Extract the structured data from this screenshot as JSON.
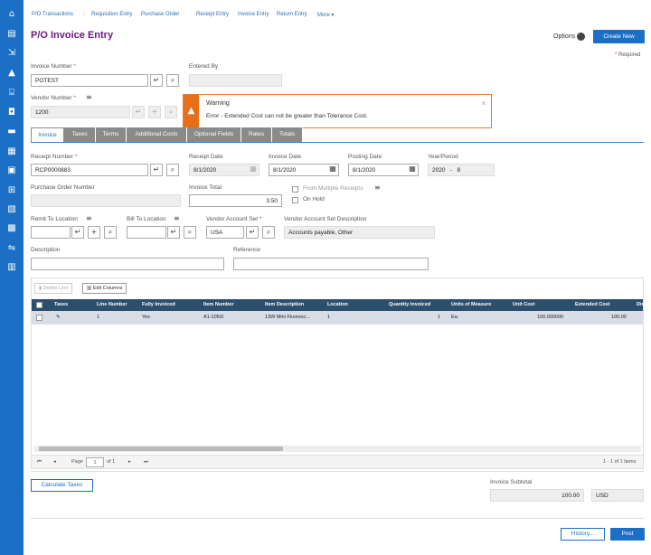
{
  "sidebar": {
    "icons": [
      "home-icon",
      "vendor-icon",
      "import-icon",
      "lock-icon",
      "bank-icon",
      "briefcase-icon",
      "folder-icon",
      "inventory-icon",
      "calendar-icon",
      "grid-icon",
      "report-icon",
      "chart-icon",
      "transfer-icon",
      "analytics-icon"
    ]
  },
  "topnav": {
    "items": [
      "P/O Transactions",
      ":",
      "Requisition Entry",
      "Purchase Order",
      "Receipt Entry",
      "Invoice Entry",
      "Return Entry",
      "More ▾"
    ]
  },
  "header": {
    "title": "P/O Invoice Entry",
    "options_label": "Options",
    "create_new_label": "Create New",
    "required_note": "Required",
    "required_star": "*"
  },
  "form": {
    "invoice_number_label": "Invoice Number",
    "invoice_number_value": "POTEST",
    "entered_by_label": "Entered By",
    "entered_by_value": "",
    "vendor_number_label": "Vendor Number",
    "vendor_number_value": "1200",
    "star": "*"
  },
  "warning": {
    "title": "Warning",
    "message": "Error - Extended Cost can not be greater than Tolerance Cost.",
    "close": "×"
  },
  "tabs": [
    "Invoice",
    "Taxes",
    "Terms",
    "Additional Costs",
    "Optional Fields",
    "Rates",
    "Totals"
  ],
  "invoice": {
    "receipt_number_label": "Receipt Number",
    "receipt_number_value": "RCP0000883",
    "receipt_date_label": "Receipt Date",
    "receipt_date_value": "8/1/2020",
    "invoice_date_label": "Invoice Date",
    "invoice_date_value": "8/1/2020",
    "posting_date_label": "Posting Date",
    "posting_date_value": "8/1/2020",
    "year_period_label": "Year/Period",
    "year_value": "2020",
    "period_sep": "-",
    "period_value": "8",
    "po_number_label": "Purchase Order Number",
    "po_number_value": "",
    "invoice_total_label": "Invoice Total",
    "invoice_total_value": "3.50",
    "from_multiple_label": "From Multiple Receipts",
    "on_hold_label": "On Hold",
    "remit_to_label": "Remit To Location",
    "bill_to_label": "Bill To Location",
    "vendor_account_set_label": "Vendor Account Set",
    "vendor_account_set_value": "USA",
    "vendor_account_desc_label": "Vendor Account Set Description",
    "vendor_account_desc_value": "Accounts payable, Other",
    "description_label": "Description",
    "reference_label": "Reference"
  },
  "grid": {
    "delete_line_label": "Delete Line",
    "edit_columns_label": "Edit Columns",
    "columns": [
      "Taxes",
      "Line Number",
      "Fully Invoiced",
      "Item Number",
      "Item Description",
      "Location",
      "Quantity Invoiced",
      "Units of Measure",
      "Unit Cost",
      "Extended Cost",
      "Dis"
    ],
    "rows": [
      {
        "taxes": "✎",
        "line": "1",
        "fully_invoiced": "Yes",
        "item_number": "A1-105/0",
        "item_desc": "13W Mini Fluoresc...",
        "location": "1",
        "qty": "1",
        "uom": "Ea.",
        "unit_cost": "100.000000",
        "ext_cost": "100.00"
      }
    ],
    "pager": {
      "page_label": "Page",
      "page_value": "1",
      "of_label": "of 1",
      "count_label": "1 - 1 of 1 items"
    }
  },
  "footer": {
    "calculate_taxes_label": "Calculate Taxes",
    "subtotal_label": "Invoice Subtotal",
    "subtotal_value": "100.00",
    "currency": "USD",
    "history_label": "History...",
    "post_label": "Post"
  },
  "colors": {
    "accent": "#1b6fc4",
    "title": "#6a1a7a",
    "warning": "#e86f1a",
    "grid_header": "#2d4f6e"
  }
}
